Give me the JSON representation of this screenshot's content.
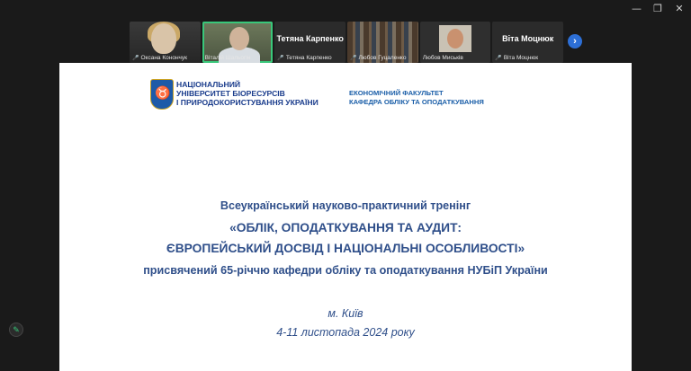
{
  "window": {
    "controls": [
      "—",
      "❐",
      "✕"
    ]
  },
  "participants": [
    {
      "name": "Оксана Конончук",
      "video": true
    },
    {
      "name": "Віталій Шальогін",
      "video": true,
      "active": true
    },
    {
      "name": "Тетяна Карпенко",
      "big_name": "Тетяна Карпенко",
      "video": false
    },
    {
      "name": "Любов Гуцаленко",
      "video": true
    },
    {
      "name": "Любов Миськів",
      "video": true
    },
    {
      "name": "Віта Моцнюк",
      "big_name": "Віта Моцнюк",
      "video": false
    }
  ],
  "slide": {
    "university": [
      "НАЦІОНАЛЬНИЙ",
      "УНІВЕРСИТЕТ БІОРЕСУРСІВ",
      "І ПРИРОДОКОРИСТУВАННЯ УКРАЇНИ"
    ],
    "faculty": [
      "ЕКОНОМІЧНИЙ ФАКУЛЬТЕТ",
      "КАФЕДРА ОБЛІКУ ТА ОПОДАТКУВАННЯ"
    ],
    "title_line1": "Всеукраїнський науково-практичний тренінг",
    "title_line2": "«ОБЛІК, ОПОДАТКУВАННЯ ТА АУДИТ:",
    "title_line3": "ЄВРОПЕЙСЬКИЙ ДОСВІД І НАЦІОНАЛЬНІ ОСОБЛИВОСТІ»",
    "title_line4": "присвячений 65-річчю кафедри обліку та оподаткування НУБіП України",
    "city": "м. Київ",
    "dates": "4-11 листопада 2024 року"
  },
  "icons": {
    "next": "chevron-right-icon",
    "pen": "pen-icon",
    "mic": "mic-muted-icon"
  },
  "colors": {
    "active_speaker": "#39c77a",
    "accent_blue": "#2d6fd6",
    "slide_text": "#2f4f8a"
  }
}
